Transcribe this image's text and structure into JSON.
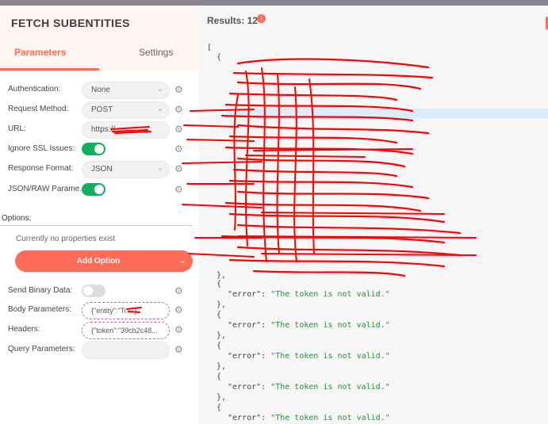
{
  "node": {
    "title": "FETCH SUBENTITIES",
    "tabs": {
      "parameters": "Parameters",
      "settings": "Settings"
    }
  },
  "params": {
    "authentication": {
      "label": "Authentication:",
      "value": "None"
    },
    "method": {
      "label": "Request Method:",
      "value": "POST"
    },
    "url": {
      "label": "URL:",
      "value": "https://"
    },
    "ignore_ssl": {
      "label": "Ignore SSL Issues:",
      "on": true
    },
    "response_format": {
      "label": "Response Format:",
      "value": "JSON"
    },
    "json_raw": {
      "label": "JSON/RAW Parame...",
      "on": true
    },
    "options_label": "Options:",
    "no_properties": "Currently no properties exist",
    "add_option": "Add Option",
    "send_binary": {
      "label": "Send Binary Data:",
      "on": false
    },
    "body_parameters": {
      "label": "Body Parameters:",
      "value": "{\"entity\":\"Ti...\"}"
    },
    "headers": {
      "label": "Headers:",
      "value": "{\"token\":\"39cb2c48..."
    },
    "query_parameters": {
      "label": "Query Parameters:",
      "value": ""
    }
  },
  "results": {
    "label": "Results: 12",
    "info_icon": "i",
    "json_open_bracket": "[",
    "obj_open": "{",
    "obj_close": "},",
    "error_key": "\"error\"",
    "error_value": "\"The token is not valid.\""
  },
  "colors": {
    "accent": "#ff6d5a",
    "toggle_on": "#13ae5c",
    "json_string": "#2b8a3e",
    "redaction": "#ff0000"
  }
}
